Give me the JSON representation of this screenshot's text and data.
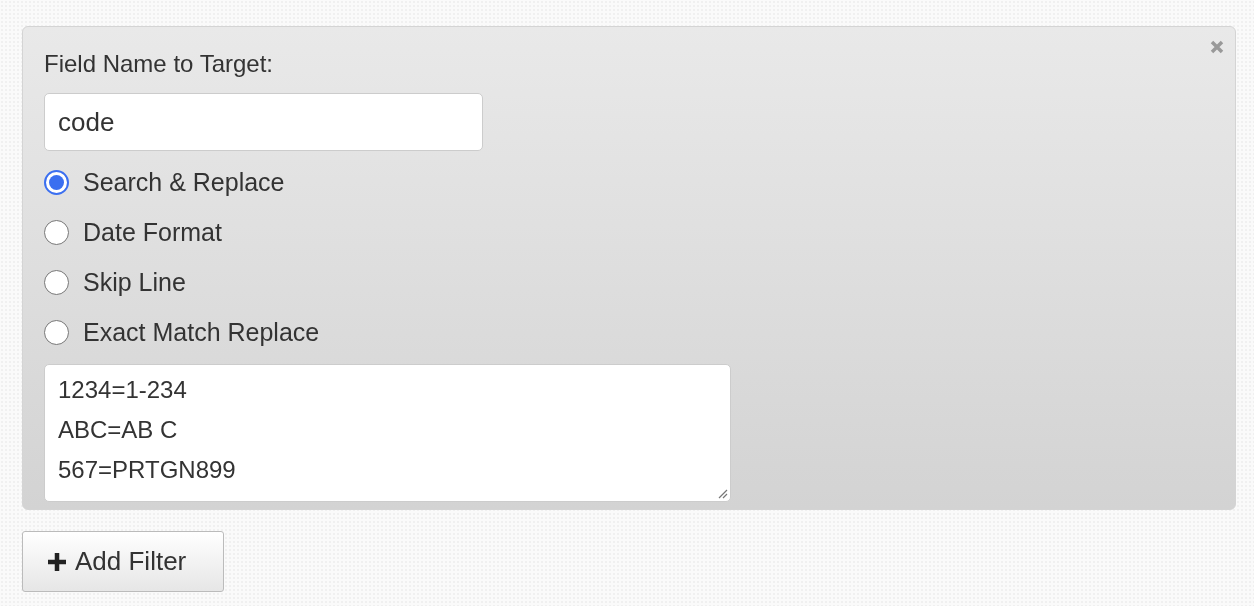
{
  "filter_panel": {
    "field_label": "Field Name to Target:",
    "field_value": "code",
    "options": [
      {
        "label": "Search & Replace",
        "selected": true
      },
      {
        "label": "Date Format",
        "selected": false
      },
      {
        "label": "Skip Line",
        "selected": false
      },
      {
        "label": "Exact Match Replace",
        "selected": false
      }
    ],
    "mappings": "1234=1-234\nABC=AB C\n567=PRTGN899"
  },
  "add_button": {
    "label": "Add Filter"
  }
}
